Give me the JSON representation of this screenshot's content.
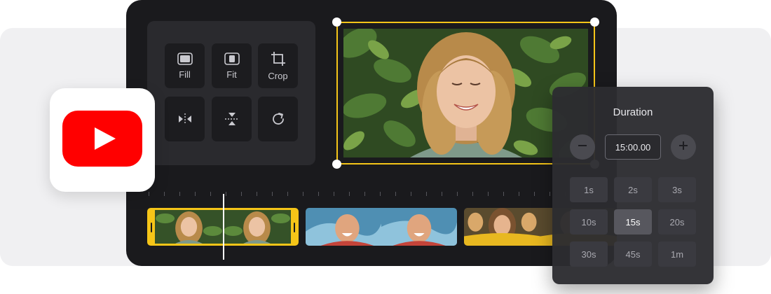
{
  "tools": {
    "fill_label": "Fill",
    "fit_label": "Fit",
    "crop_label": "Crop"
  },
  "duration": {
    "title": "Duration",
    "value": "15:00.00",
    "presets": [
      "1s",
      "2s",
      "3s",
      "10s",
      "15s",
      "20s",
      "30s",
      "45s",
      "1m"
    ],
    "selected_preset": "15s"
  },
  "colors": {
    "accent": "#f5c518",
    "youtube_red": "#ff0000",
    "editor_bg": "#1a1a1d"
  },
  "icons": [
    "fill-icon",
    "fit-icon",
    "crop-icon",
    "flip-horizontal-icon",
    "flip-vertical-icon",
    "rotate-icon",
    "minus-icon",
    "plus-icon",
    "youtube-logo"
  ]
}
